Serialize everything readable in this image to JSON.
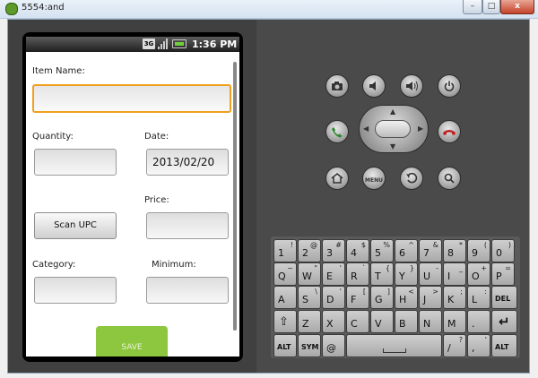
{
  "window": {
    "title": "5554:and",
    "min_label": "–",
    "max_label": "□",
    "close_label": "x"
  },
  "statusbar": {
    "network": "3G",
    "time": "1:36 PM"
  },
  "form": {
    "item_name_label": "Item Name:",
    "item_name_value": "",
    "quantity_label": "Quantity:",
    "quantity_value": "",
    "date_label": "Date:",
    "date_value": "2013/02/20",
    "price_label": "Price:",
    "price_value": "",
    "scan_label": "Scan UPC",
    "category_label": "Category:",
    "category_value": "",
    "minimum_label": "Minimum:",
    "minimum_value": "",
    "save_label": "SAVE"
  },
  "controls": {
    "menu_label": "MENU",
    "icons": [
      "camera-icon",
      "volume-down-icon",
      "volume-up-icon",
      "power-icon",
      "call-icon",
      "end-call-icon",
      "home-icon",
      "menu-icon",
      "back-icon",
      "search-icon"
    ]
  },
  "keyboard": {
    "row1": [
      {
        "m": "1",
        "s": "!"
      },
      {
        "m": "2",
        "s": "@"
      },
      {
        "m": "3",
        "s": "#"
      },
      {
        "m": "4",
        "s": "$"
      },
      {
        "m": "5",
        "s": "%"
      },
      {
        "m": "6",
        "s": "^"
      },
      {
        "m": "7",
        "s": "&"
      },
      {
        "m": "8",
        "s": "*"
      },
      {
        "m": "9",
        "s": "("
      },
      {
        "m": "0",
        "s": ")"
      }
    ],
    "row2": [
      {
        "m": "Q",
        "s": "~"
      },
      {
        "m": "W",
        "s": "\""
      },
      {
        "m": "E",
        "s": "'"
      },
      {
        "m": "R",
        "s": "`"
      },
      {
        "m": "T",
        "s": "{"
      },
      {
        "m": "Y",
        "s": "}"
      },
      {
        "m": "U",
        "s": "-"
      },
      {
        "m": "I",
        "s": "_"
      },
      {
        "m": "O",
        "s": "+"
      },
      {
        "m": "P",
        "s": "="
      }
    ],
    "row3": [
      {
        "m": "A",
        "s": ""
      },
      {
        "m": "S",
        "s": "\\"
      },
      {
        "m": "D",
        "s": "'"
      },
      {
        "m": "F",
        "s": "["
      },
      {
        "m": "G",
        "s": "]"
      },
      {
        "m": "H",
        "s": "<"
      },
      {
        "m": "J",
        "s": ">"
      },
      {
        "m": "K",
        "s": ";"
      },
      {
        "m": "L",
        "s": ":"
      }
    ],
    "del_label": "DEL",
    "row4": [
      {
        "m": "Z",
        "s": ""
      },
      {
        "m": "X",
        "s": ""
      },
      {
        "m": "C",
        "s": ""
      },
      {
        "m": "V",
        "s": ""
      },
      {
        "m": "B",
        "s": ""
      },
      {
        "m": "N",
        "s": ""
      },
      {
        "m": "M",
        "s": ""
      },
      {
        "m": ".",
        "s": ""
      }
    ],
    "alt_label": "ALT",
    "sym_label": "SYM",
    "at_label": "@",
    "slash_label": "/",
    "slash_sub": "?",
    "comma_label": ",",
    "comma_sub": "'"
  }
}
